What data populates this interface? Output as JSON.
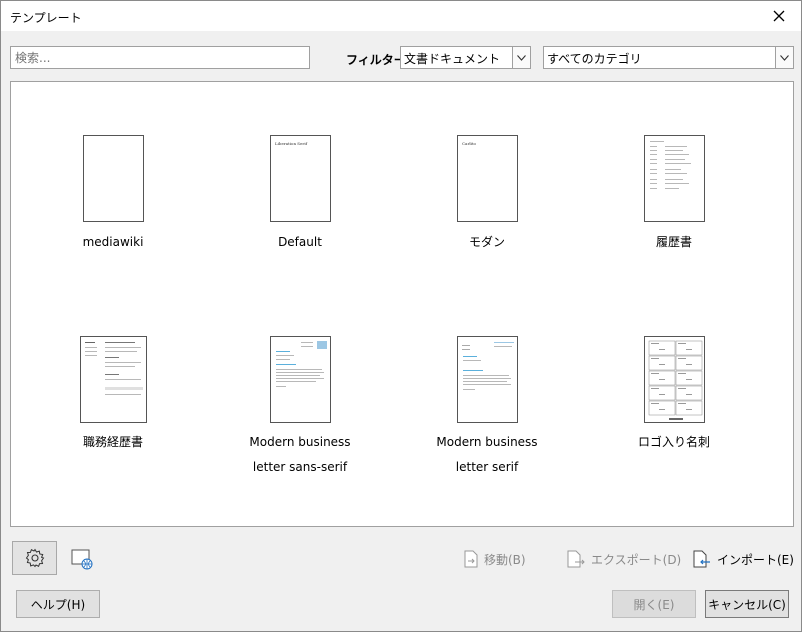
{
  "window": {
    "title": "テンプレート"
  },
  "search": {
    "placeholder": "検索..."
  },
  "filter": {
    "label": "フィルター",
    "type_selected": "文書ドキュメント",
    "category_selected": "すべてのカテゴリ"
  },
  "templates": [
    {
      "label": "mediawiki",
      "label2": "",
      "thumb_text": ""
    },
    {
      "label": "Default",
      "label2": "",
      "thumb_text": "Liberation Serif"
    },
    {
      "label": "モダン",
      "label2": "",
      "thumb_text": "Carlito"
    },
    {
      "label": "履歴書",
      "label2": "",
      "thumb_text": ""
    },
    {
      "label": "職務経歴書",
      "label2": "",
      "thumb_text": ""
    },
    {
      "label": "Modern business",
      "label2": "letter sans-serif",
      "thumb_text": ""
    },
    {
      "label": "Modern business",
      "label2": "letter serif",
      "thumb_text": ""
    },
    {
      "label": "ロゴ入り名刺",
      "label2": "",
      "thumb_text": ""
    }
  ],
  "actions": {
    "move": "移動(B)",
    "export": "エクスポート(D)",
    "import": "インポート(E)"
  },
  "buttons": {
    "help": "ヘルプ(H)",
    "open": "開く(E)",
    "cancel": "キャンセル(C)"
  },
  "icons": {
    "close": "close-icon",
    "settings": "gear-icon",
    "online": "globe-document-icon"
  }
}
